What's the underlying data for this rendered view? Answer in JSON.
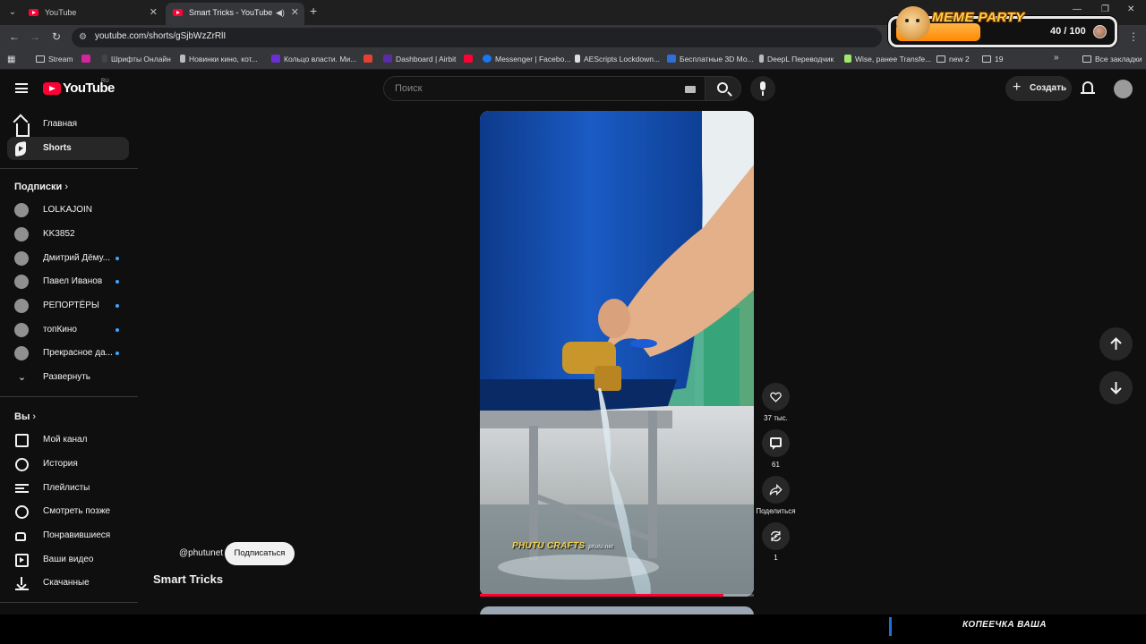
{
  "browser": {
    "tabs": [
      {
        "label": "YouTube",
        "active": false
      },
      {
        "label": "Smart Tricks - YouTube",
        "active": true
      }
    ],
    "url": "youtube.com/shorts/gSjbWzZrRlI",
    "bookmarks": [
      {
        "label": "Stream",
        "icon": "folder-icon"
      },
      {
        "label": "",
        "icon": "red-app-icon"
      },
      {
        "label": "Шрифты Онлайн",
        "icon": "font-icon"
      },
      {
        "label": "Новинки кино, кот...",
        "icon": "film-icon"
      },
      {
        "label": "Кольцо власти. Ми...",
        "icon": "ring-icon"
      },
      {
        "label": "",
        "icon": "gmail-icon"
      },
      {
        "label": "Dashboard | Airbit",
        "icon": "airbit-icon"
      },
      {
        "label": "",
        "icon": "youtube-icon"
      },
      {
        "label": "Messenger | Facebo...",
        "icon": "facebook-icon"
      },
      {
        "label": "AEScripts Lockdown...",
        "icon": "aescripts-icon"
      },
      {
        "label": "Бесплатные 3D Мо...",
        "icon": "3d-icon"
      },
      {
        "label": "DeepL Переводчик",
        "icon": "deepl-icon"
      },
      {
        "label": "Wise, ранее Transfe...",
        "icon": "wise-icon"
      },
      {
        "label": "new 2",
        "icon": "folder-icon"
      },
      {
        "label": "19",
        "icon": "folder-icon"
      }
    ],
    "all_bookmarks": "Все закладки",
    "more_bookmarks": "»"
  },
  "meme_widget": {
    "title": "MEME PARTY",
    "score": "40 / 100",
    "progress": 0.4
  },
  "masthead": {
    "logo": "YouTube",
    "region": "RU",
    "search_placeholder": "Поиск",
    "create_label": "Создать"
  },
  "sidebar": {
    "main": [
      {
        "label": "Главная",
        "icon": "home-icon"
      },
      {
        "label": "Shorts",
        "icon": "shorts-icon",
        "active": true
      }
    ],
    "subscriptions_title": "Подписки",
    "subscriptions": [
      {
        "label": "LOLKAJOIN",
        "new": false
      },
      {
        "label": "KK3852",
        "new": false
      },
      {
        "label": "Дмитрий Дёму...",
        "new": true
      },
      {
        "label": "Павел Иванов",
        "new": true
      },
      {
        "label": "РЕПОРТЁРЫ",
        "new": true
      },
      {
        "label": "топКино",
        "new": true
      },
      {
        "label": "Прекрасное да...",
        "new": true
      }
    ],
    "expand_label": "Развернуть",
    "you_title": "Вы",
    "you_items": [
      {
        "label": "Мой канал",
        "icon": "channel-icon"
      },
      {
        "label": "История",
        "icon": "history-icon"
      },
      {
        "label": "Плейлисты",
        "icon": "playlists-icon"
      },
      {
        "label": "Смотреть позже",
        "icon": "watch-later-icon"
      },
      {
        "label": "Понравившиеся",
        "icon": "like-icon"
      },
      {
        "label": "Ваши видео",
        "icon": "your-videos-icon"
      },
      {
        "label": "Скачанные",
        "icon": "downloads-icon"
      }
    ]
  },
  "short": {
    "channel": "@phutunet",
    "subscribe_label": "Подписаться",
    "title": "Smart Tricks",
    "watermark": "PHUTU CRAFTS",
    "watermark_small": "phutu.net",
    "progress": 0.89,
    "likes": "37 тыс.",
    "comments": "61",
    "share_label": "Поделиться",
    "remix": "1"
  },
  "overlay": {
    "caption": "КОПЕЕЧКА ВАША"
  },
  "colors": {
    "yt_red": "#ff0033",
    "background": "#0f0f0f",
    "chip": "#272727",
    "accent_blue": "#3ea6ff"
  }
}
